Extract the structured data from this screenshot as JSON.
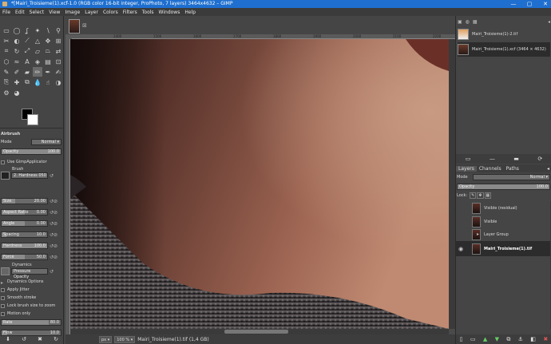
{
  "window": {
    "title": "*[Mairi_Troisieme(1).xcf-1.0 (RGB color 16-bit integer, ProPhoto, 7 layers) 3464x4632 – GIMP",
    "minimize": "—",
    "maximize": "▢",
    "close": "✕"
  },
  "menu": [
    "File",
    "Edit",
    "Select",
    "View",
    "Image",
    "Layer",
    "Colors",
    "Filters",
    "Tools",
    "Windows",
    "Help"
  ],
  "tool_options": {
    "header": "Airbrush",
    "mode_label": "Mode",
    "mode_value": "Normal",
    "opacity_label": "Opacity",
    "opacity_value": "100.0",
    "use_applicator": "Use GimpApplicator",
    "brush_label": "Brush",
    "brush_value": "2. Hardness 050",
    "sliders": [
      {
        "label": "Size",
        "value": "20.00",
        "fill": 0.3
      },
      {
        "label": "Aspect Ratio",
        "value": "0.00",
        "fill": 0.5
      },
      {
        "label": "Angle",
        "value": "0.00",
        "fill": 0.5
      },
      {
        "label": "Spacing",
        "value": "10.0",
        "fill": 0.1
      },
      {
        "label": "Hardness",
        "value": "100.0",
        "fill": 1.0
      },
      {
        "label": "Force",
        "value": "50.0",
        "fill": 0.5
      }
    ],
    "dynamics_label": "Dynamics",
    "dynamics_value": "Pressure Opacity",
    "checks": [
      "Dynamics Options",
      "Apply Jitter",
      "Smooth stroke",
      "Lock brush size to zoom",
      "Motion only"
    ],
    "rate_label": "Rate",
    "rate_value": "80.0",
    "rate_fill": 0.8,
    "flow_label": "Flow",
    "flow_value": "10.0",
    "flow_fill": 0.1
  },
  "ruler_top": [
    "1400",
    "1500",
    "1600",
    "1700",
    "1800",
    "1900",
    "2000",
    "2100",
    "2200",
    "2300"
  ],
  "status": {
    "unit": "px",
    "zoom": "100 %",
    "info": "Mairi_Troisieme(1).tif (1,4 GB)"
  },
  "images": [
    {
      "name": "Mairi_Troisieme(1)-2.tif"
    },
    {
      "name": "Mairi_Troisieme(1).xcf (3464 × 4632)"
    }
  ],
  "layers_panel": {
    "tabs": [
      "Layers",
      "Channels",
      "Paths"
    ],
    "mode_label": "Mode",
    "mode_value": "Normal",
    "opacity_label": "Opacity",
    "opacity_value": "100.0",
    "lock_label": "Lock:",
    "layers": [
      {
        "name": "Visible (residual)",
        "bold": false
      },
      {
        "name": "Visible",
        "bold": false
      },
      {
        "name": "Layer Group",
        "bold": false
      },
      {
        "name": "Mairi_Troisieme(1).tif",
        "bold": true
      }
    ]
  }
}
